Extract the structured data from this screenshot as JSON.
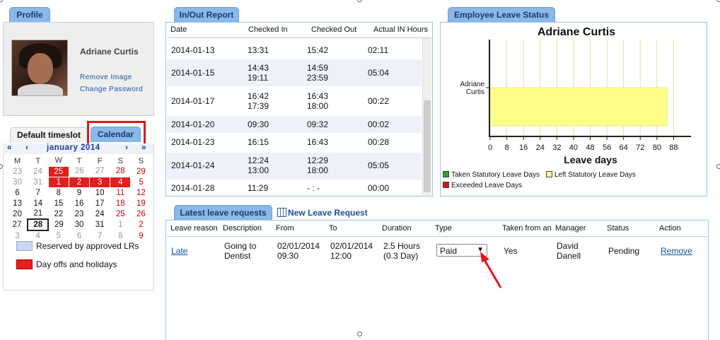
{
  "profile": {
    "tab": "Profile",
    "name": "Adriane Curtis",
    "remove_image": "Remove Image",
    "change_password": "Change Password"
  },
  "timeslot_tabs": {
    "default": "Default timeslot",
    "calendar": "Calendar"
  },
  "calendar": {
    "prev_year": "«",
    "prev_month": "‹",
    "month_label": "january 2014",
    "next_month": "›",
    "next_year": "»",
    "dow": [
      "M",
      "T",
      "W",
      "T",
      "F",
      "S",
      "S"
    ],
    "weeks": [
      [
        "23",
        "24",
        "25",
        "26",
        "27",
        "28",
        "29"
      ],
      [
        "30",
        "31",
        "1",
        "2",
        "3",
        "4",
        "5"
      ],
      [
        "6",
        "7",
        "8",
        "9",
        "10",
        "11",
        "12"
      ],
      [
        "13",
        "14",
        "15",
        "16",
        "17",
        "18",
        "19"
      ],
      [
        "20",
        "21",
        "22",
        "23",
        "24",
        "25",
        "26"
      ],
      [
        "27",
        "28",
        "29",
        "30",
        "31",
        "1",
        "2"
      ],
      [
        "3",
        "4",
        "5",
        "6",
        "7",
        "8",
        "9"
      ]
    ],
    "legend": {
      "reserved": "Reserved by approved LRs",
      "dayoff": "Day offs and holidays"
    },
    "colors": {
      "reserved": "#c8d8f4",
      "dayoff": "#e21e1e"
    }
  },
  "inout": {
    "tab": "In/Out Report",
    "headers": [
      "Date",
      "Checked In",
      "Checked Out",
      "Actual IN Hours"
    ],
    "rows": [
      {
        "date": "2014-01-13",
        "in": "13:31",
        "out": "15:42",
        "hours": "02:11"
      },
      {
        "date": "2014-01-15",
        "in": "14:43\n19:11",
        "out": "14:59\n23:59",
        "hours": "05:04"
      },
      {
        "date": "2014-01-17",
        "in": "16:42\n17:39",
        "out": "16:43\n18:00",
        "hours": "00:22"
      },
      {
        "date": "2014-01-20",
        "in": "09:30",
        "out": "09:32",
        "hours": "00:02"
      },
      {
        "date": "2014-01-23",
        "in": "16:15",
        "out": "16:43",
        "hours": "00:28"
      },
      {
        "date": "2014-01-24",
        "in": "12:24\n13:00",
        "out": "12:29\n18:00",
        "hours": "05:05"
      },
      {
        "date": "2014-01-28",
        "in": "11:29",
        "out": "- : -",
        "hours": "00:00"
      }
    ]
  },
  "leave_status": {
    "tab": "Employee Leave Status"
  },
  "chart_data": {
    "type": "bar",
    "orientation": "horizontal",
    "title": "Adriane Curtis",
    "categories": [
      "Adriane Curtis"
    ],
    "xlabel": "Leave days",
    "ylabel": "",
    "xlim": [
      0,
      96
    ],
    "xticks": [
      "0",
      "8",
      "16",
      "24",
      "32",
      "40",
      "48",
      "56",
      "64",
      "72",
      "80",
      "88"
    ],
    "grid": "vertical",
    "series": [
      {
        "name": "Taken Statutory Leave Days",
        "color": "#22aa22",
        "values": [
          0
        ]
      },
      {
        "name": "Left Statutory Leave Days",
        "color": "#ffff88",
        "values": [
          85
        ]
      },
      {
        "name": "Exceeded Leave Days",
        "color": "#dd1111",
        "values": [
          0
        ]
      }
    ],
    "legend_position": "bottom-left"
  },
  "leave_requests": {
    "tab": "Latest leave requests",
    "new_request": "New Leave Request",
    "headers": [
      "Leave reason",
      "Description",
      "From",
      "To",
      "Duration",
      "Type",
      "Taken from an",
      "Manager",
      "Status",
      "Action"
    ],
    "rows": [
      {
        "reason": "Late",
        "description": "Going to\nDentist",
        "from": "02/01/2014\n09:30",
        "to": "02/01/2014\n12:00",
        "duration": "2.5 Hours\n(0.3 Day)",
        "type": "Paid",
        "taken_from": "Yes",
        "manager": "David\nDanell",
        "status": "Pending",
        "action": "Remove"
      }
    ]
  }
}
